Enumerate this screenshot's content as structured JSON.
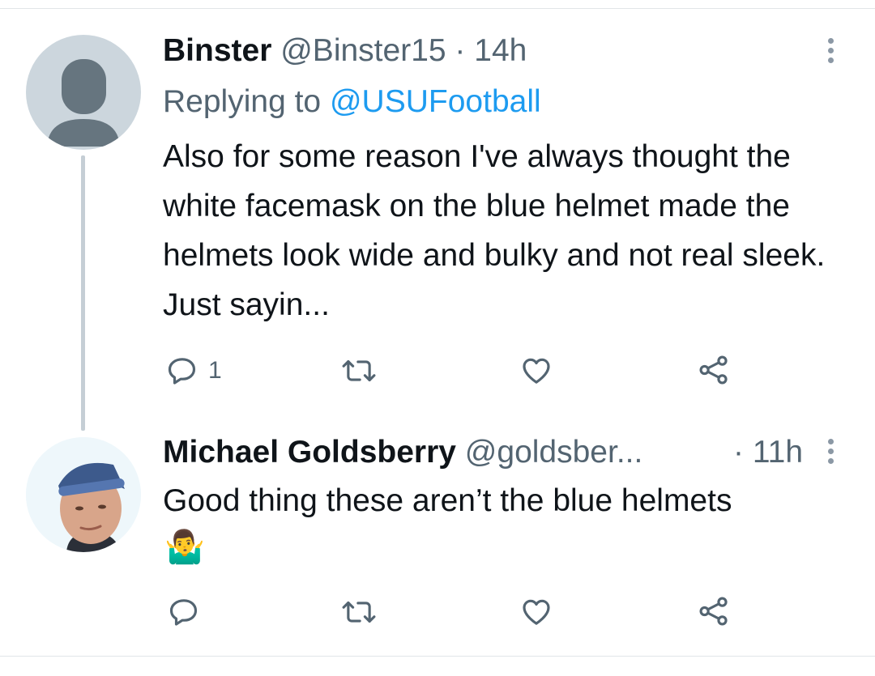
{
  "tweet1": {
    "display_name": "Binster",
    "handle": "@Binster15",
    "separator": "·",
    "time": "14h",
    "replying_prefix": "Replying to",
    "replying_to": "@USUFootball",
    "text": "Also for some reason I've always thought the white facemask on the blue helmet made the helmets look wide and bulky and not real sleek. Just sayin...",
    "reply_count": "1"
  },
  "tweet2": {
    "display_name": "Michael Goldsberry",
    "handle": "@goldsber...",
    "separator": "·",
    "time": "11h",
    "text": "Good thing these aren’t the blue helmets",
    "emoji": "🤷‍♂️"
  },
  "colors": {
    "accent": "#1d9bf0",
    "muted_text": "#536471",
    "icon": "#536471",
    "thread_line": "#c5ced5",
    "divider": "#e1e5e8"
  },
  "icons": [
    "reply-icon",
    "retweet-icon",
    "like-icon",
    "share-icon",
    "more-icon"
  ]
}
